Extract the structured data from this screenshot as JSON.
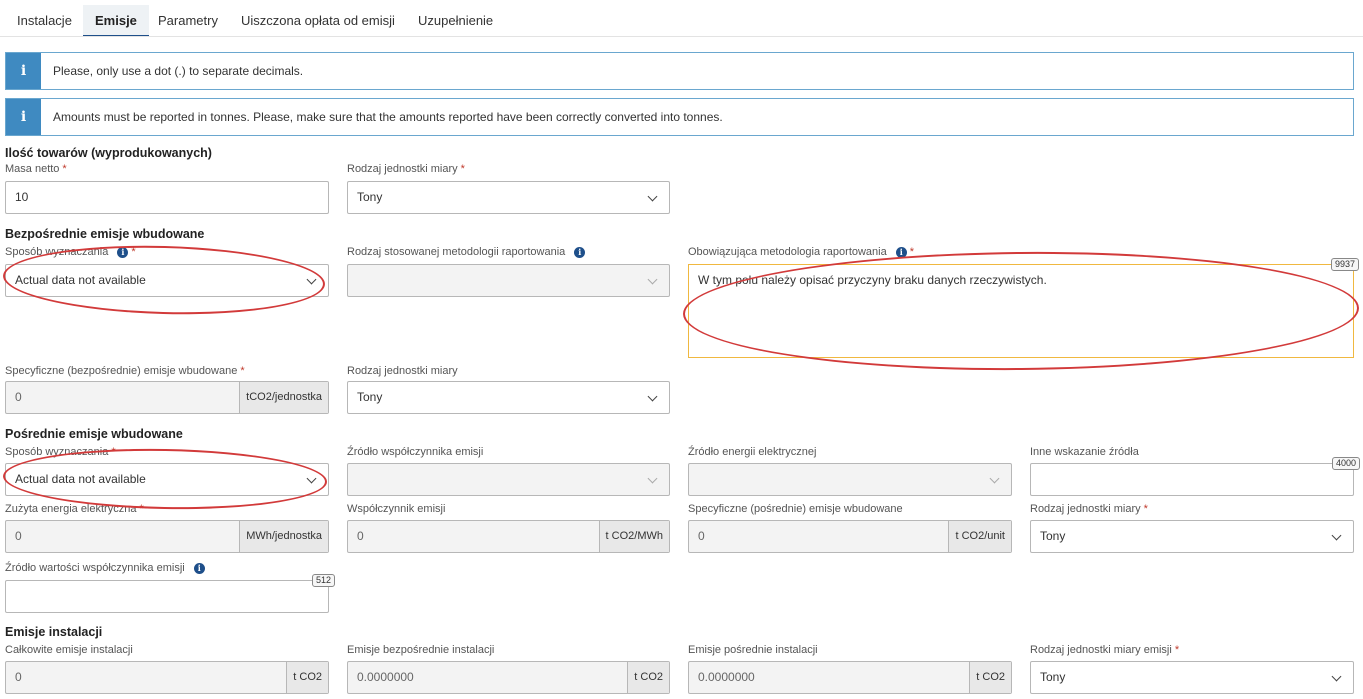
{
  "tabs": [
    "Instalacje",
    "Emisje",
    "Parametry",
    "Uiszczona opłata od emisji",
    "Uzupełnienie"
  ],
  "active_tab": "Emisje",
  "info": [
    "Please, only use a dot (.) to separate decimals.",
    "Amounts must be reported in tonnes. Please, make sure that the amounts reported have been correctly converted into tonnes."
  ],
  "goods": {
    "title": "Ilość towarów (wyprodukowanych)",
    "mass_label": "Masa netto",
    "mass_value": "10",
    "unit_label": "Rodzaj jednostki miary",
    "unit_value": "Tony"
  },
  "direct": {
    "title": "Bezpośrednie emisje wbudowane",
    "method_label": "Sposób wyznaczania",
    "method_value": "Actual data not available",
    "reporting_type_label": "Rodzaj stosowanej metodologii raportowania",
    "applicable_label": "Obowiązująca metodologia raportowania",
    "applicable_text": "W tym polu należy opisać przyczyny braku danych rzeczywistych.",
    "applicable_counter": "9937",
    "specific_label": "Specyficzne (bezpośrednie) emisje wbudowane",
    "specific_value": "0",
    "specific_unit": "tCO2/jednostka",
    "unit_label": "Rodzaj jednostki miary",
    "unit_value": "Tony"
  },
  "indirect": {
    "title": "Pośrednie emisje wbudowane",
    "method_label": "Sposób wyznaczania",
    "method_value": "Actual data not available",
    "ef_source_label": "Źródło współczynnika emisji",
    "elec_source_label": "Źródło energii elektrycznej",
    "other_label": "Inne wskazanie źródła",
    "other_counter": "4000",
    "energy_label": "Zużyta energia elektryczna",
    "energy_value": "0",
    "energy_unit": "MWh/jednostka",
    "ef_label": "Współczynnik emisji",
    "ef_value": "0",
    "ef_unit": "t CO2/MWh",
    "specific_label": "Specyficzne (pośrednie) emisje wbudowane",
    "specific_value": "0",
    "specific_unit": "t CO2/unit",
    "unit_label": "Rodzaj jednostki miary",
    "unit_value": "Tony",
    "ef_value_source_label": "Źródło wartości współczynnika emisji",
    "ef_value_source_counter": "512"
  },
  "installation": {
    "title": "Emisje instalacji",
    "total_label": "Całkowite emisje instalacji",
    "total_value": "0",
    "total_unit": "t CO2",
    "direct_label": "Emisje bezpośrednie instalacji",
    "direct_value": "0.0000000",
    "direct_unit": "t CO2",
    "indirect_label": "Emisje pośrednie instalacji",
    "indirect_value": "0.0000000",
    "indirect_unit": "t CO2",
    "unit_label": "Rodzaj jednostki miary emisji",
    "unit_value": "Tony"
  },
  "colors": {
    "accent": "#1e4f8a",
    "info": "#3f8ac1",
    "required": "#c0392b",
    "annotation": "#d23a3a",
    "focus": "#f0b840"
  }
}
